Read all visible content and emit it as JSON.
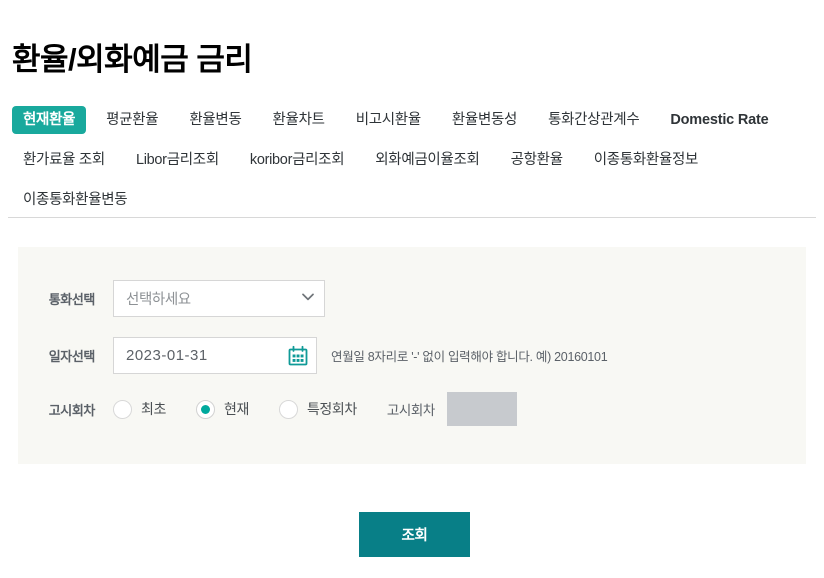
{
  "page": {
    "title": "환율/외화예금 금리"
  },
  "tabs": [
    {
      "label": "현재환율",
      "active": true,
      "latin": false
    },
    {
      "label": "평균환율",
      "active": false,
      "latin": false
    },
    {
      "label": "환율변동",
      "active": false,
      "latin": false
    },
    {
      "label": "환율차트",
      "active": false,
      "latin": false
    },
    {
      "label": "비고시환율",
      "active": false,
      "latin": false
    },
    {
      "label": "환율변동성",
      "active": false,
      "latin": false
    },
    {
      "label": "통화간상관계수",
      "active": false,
      "latin": false
    },
    {
      "label": "Domestic Rate",
      "active": false,
      "latin": true
    },
    {
      "label": "환가료율 조회",
      "active": false,
      "latin": false
    },
    {
      "label": "Libor금리조회",
      "active": false,
      "latin": false
    },
    {
      "label": "koribor금리조회",
      "active": false,
      "latin": false
    },
    {
      "label": "외화예금이율조회",
      "active": false,
      "latin": false
    },
    {
      "label": "공항환율",
      "active": false,
      "latin": false
    },
    {
      "label": "이종통화환율정보",
      "active": false,
      "latin": false
    },
    {
      "label": "이종통화환율변동",
      "active": false,
      "latin": false
    }
  ],
  "form": {
    "currency": {
      "label": "통화선택",
      "selected": "선택하세요",
      "options": [
        "선택하세요"
      ]
    },
    "date": {
      "label": "일자선택",
      "value": "2023-01-31",
      "help": "연월일 8자리로 '-' 없이 입력해야 합니다. 예) 20160101",
      "calendar_icon": "calendar-icon"
    },
    "round": {
      "label": "고시회차",
      "options": [
        {
          "label": "최초",
          "selected": false
        },
        {
          "label": "현재",
          "selected": true
        },
        {
          "label": "특정회차",
          "selected": false
        }
      ],
      "number_label": "고시회차",
      "number_value": "",
      "number_disabled": true
    }
  },
  "submit": {
    "label": "조회"
  },
  "colors": {
    "accent": "#19a99d",
    "button": "#087f87",
    "radio_selected": "#00a99d",
    "panel_bg": "#f8f8f4",
    "divider": "#d8d8d8",
    "disabled_input": "#c7cace"
  }
}
